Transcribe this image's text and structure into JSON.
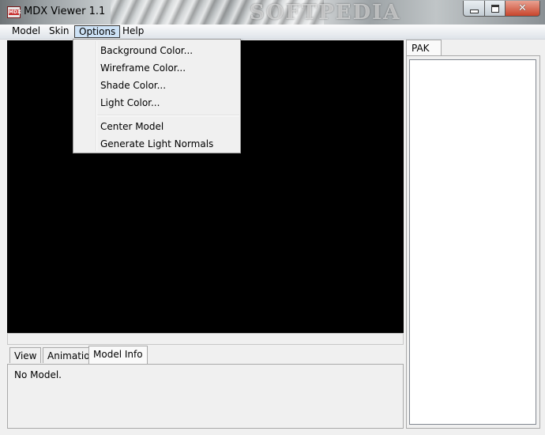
{
  "window": {
    "title": "MDX Viewer 1.1",
    "icon": "mdx-app-icon",
    "icon_text": "MDX",
    "watermark": "SOFTPEDIA"
  },
  "menubar": {
    "items": [
      {
        "label": "Model"
      },
      {
        "label": "Skin"
      },
      {
        "label": "Options",
        "active": true
      },
      {
        "label": "Help"
      }
    ]
  },
  "options_menu": {
    "items": [
      {
        "label": "Background Color..."
      },
      {
        "label": "Wireframe Color..."
      },
      {
        "label": "Shade Color..."
      },
      {
        "label": "Light Color..."
      },
      {
        "label": "Center Model"
      },
      {
        "label": "Generate Light Normals"
      }
    ]
  },
  "bottom_tabs": [
    {
      "label": "View"
    },
    {
      "label": "Animation"
    },
    {
      "label": "Model Info",
      "selected": true
    }
  ],
  "bottom_panel": {
    "status": "No Model."
  },
  "right_tabs": [
    {
      "label": "PAK",
      "selected": true
    }
  ],
  "colors": {
    "viewport_bg": "#000000",
    "menu_highlight": "#cde2f6",
    "close_button": "#c8452c"
  }
}
